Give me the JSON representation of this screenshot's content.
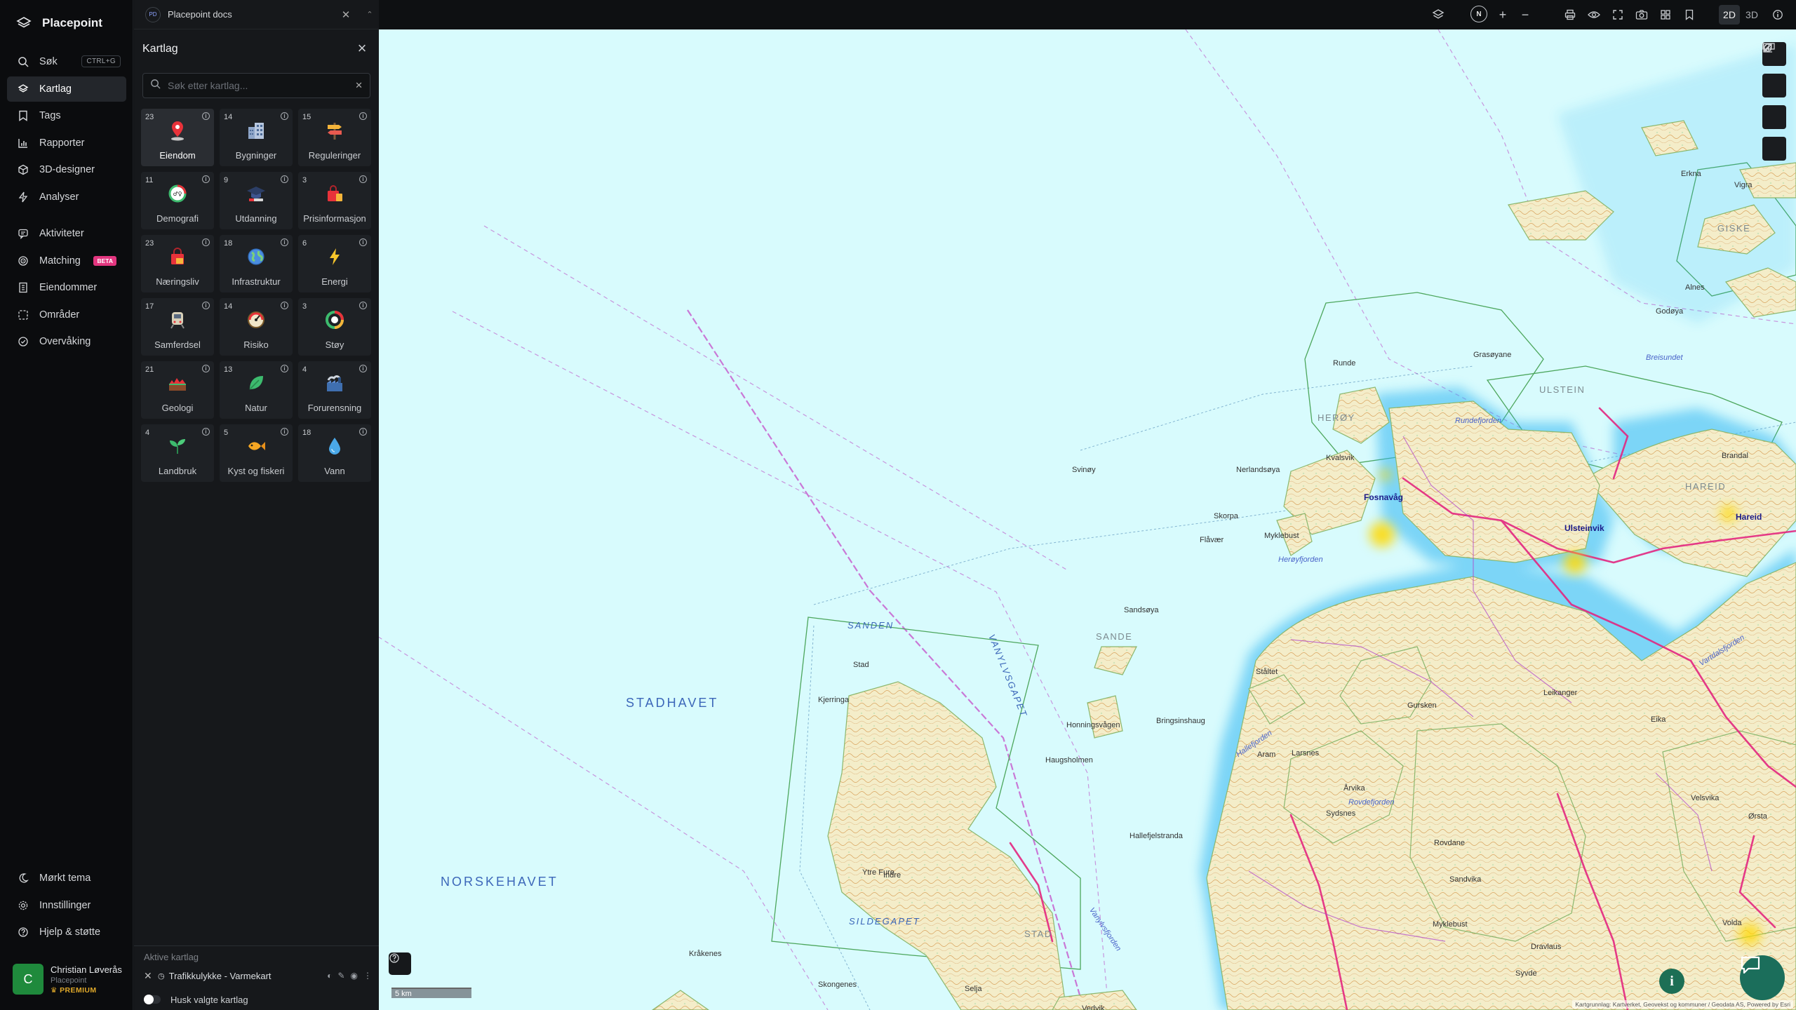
{
  "app": {
    "name": "Placepoint"
  },
  "nav": {
    "items": [
      {
        "id": "sok",
        "label": "Søk",
        "shortcut": "CTRL+G",
        "icon": "search-icon"
      },
      {
        "id": "kartlag",
        "label": "Kartlag",
        "icon": "layers-icon",
        "active": true
      },
      {
        "id": "tags",
        "label": "Tags",
        "icon": "bookmark-icon"
      },
      {
        "id": "rapporter",
        "label": "Rapporter",
        "icon": "bar-chart-icon"
      },
      {
        "id": "3d",
        "label": "3D-designer",
        "icon": "cube-icon"
      },
      {
        "id": "analyser",
        "label": "Analyser",
        "icon": "bolt-icon"
      },
      {
        "id": "aktiviteter",
        "label": "Aktiviteter",
        "icon": "activity-icon"
      },
      {
        "id": "matching",
        "label": "Matching",
        "badge": "BETA",
        "icon": "target-icon"
      },
      {
        "id": "eiendommer",
        "label": "Eiendommer",
        "icon": "building-icon"
      },
      {
        "id": "omrader",
        "label": "Områder",
        "icon": "area-icon"
      },
      {
        "id": "overvaking",
        "label": "Overvåking",
        "icon": "check-circle-icon"
      }
    ],
    "bottom": [
      {
        "id": "theme",
        "label": "Mørkt tema",
        "icon": "moon-icon"
      },
      {
        "id": "settings",
        "label": "Innstillinger",
        "icon": "gear-icon"
      },
      {
        "id": "help",
        "label": "Hjelp & støtte",
        "icon": "help-icon"
      }
    ]
  },
  "user": {
    "initial": "C",
    "name": "Christian Løverås",
    "org": "Placepoint",
    "tier": "PREMIUM"
  },
  "tab": {
    "badge": "PD",
    "title": "Placepoint docs"
  },
  "panel": {
    "title": "Kartlag",
    "search_placeholder": "Søk etter kartlag...",
    "categories": [
      {
        "count": "23",
        "label": "Eiendom",
        "icon": "pin-icon",
        "active": true
      },
      {
        "count": "14",
        "label": "Bygninger",
        "icon": "buildings-icon"
      },
      {
        "count": "15",
        "label": "Reguleringer",
        "icon": "signpost-icon"
      },
      {
        "count": "11",
        "label": "Demografi",
        "icon": "gauge-icon"
      },
      {
        "count": "9",
        "label": "Utdanning",
        "icon": "graduation-cap-icon"
      },
      {
        "count": "3",
        "label": "Prisinformasjon",
        "icon": "shopping-bag-icon"
      },
      {
        "count": "23",
        "label": "Næringsliv",
        "icon": "bag-icon"
      },
      {
        "count": "18",
        "label": "Infrastruktur",
        "icon": "globe-icon"
      },
      {
        "count": "6",
        "label": "Energi",
        "icon": "lightning-icon"
      },
      {
        "count": "17",
        "label": "Samferdsel",
        "icon": "train-icon"
      },
      {
        "count": "14",
        "label": "Risiko",
        "icon": "warning-dial-icon"
      },
      {
        "count": "3",
        "label": "Støy",
        "icon": "noise-dial-icon"
      },
      {
        "count": "21",
        "label": "Geologi",
        "icon": "terrain-icon"
      },
      {
        "count": "13",
        "label": "Natur",
        "icon": "leaf-icon"
      },
      {
        "count": "4",
        "label": "Forurensning",
        "icon": "factory-icon"
      },
      {
        "count": "4",
        "label": "Landbruk",
        "icon": "sprout-icon"
      },
      {
        "count": "5",
        "label": "Kyst og fiskeri",
        "icon": "fish-icon"
      },
      {
        "count": "18",
        "label": "Vann",
        "icon": "water-drop-icon"
      }
    ],
    "active_title": "Aktive kartlag",
    "active_layers": [
      {
        "name": "Trafikkulykke - Varmekart"
      }
    ],
    "remember_label": "Husk valgte kartlag"
  },
  "toolbar": {
    "compass": "N",
    "mode_2d": "2D",
    "mode_3d": "3D",
    "active_mode": "2D"
  },
  "map": {
    "scale_label": "5 km",
    "attribution": "Kartgrunnlag: Kartverket, Geovekst og kommuner / Geodata AS, Powered by Esri",
    "seas": [
      "STADHAVET",
      "NORSKEHAVET"
    ],
    "sea_small": [
      "SANDEN",
      "SILDEGAPET",
      "VANYLVSGAPET"
    ],
    "regions": [
      "HERØY",
      "SANDE",
      "ULSTEIN",
      "HAREID",
      "GISKE",
      "STAD"
    ],
    "towns": [
      "Fosnavåg",
      "Ulsteinvik",
      "Hareid"
    ],
    "fjords": [
      "Herøyfjorden",
      "Rundefjorden",
      "Breisundet",
      "Vartdalsfjorden",
      "Rovdefjorden",
      "Hallefjorden",
      "Vanylvsfjorden"
    ],
    "places": [
      "Runde",
      "Grasøyane",
      "Svinøy",
      "Nerlandsøya",
      "Kvalsvik",
      "Skorpa",
      "Myklebust",
      "Flåvær",
      "Sandsøya",
      "Ståltet",
      "Stad",
      "Kjerringa",
      "Honningsvågen",
      "Haugsholmen",
      "Årvika",
      "Larsnes",
      "Leikanger",
      "Ytre Fure",
      "Indre",
      "Kråkenes",
      "Skongenes",
      "Selja",
      "Vedvik",
      "Erkna",
      "Vigra",
      "Alnes",
      "Godøya",
      "Brandal",
      "Eika",
      "Velsvika",
      "Sydsnes",
      "Rovdane",
      "Myklebust",
      "Syvde",
      "Volda",
      "Ørsta",
      "Dravlaus",
      "Gursken",
      "Sandvika",
      "Hallefjelstranda",
      "Aram",
      "Bringsinshaug"
    ]
  }
}
